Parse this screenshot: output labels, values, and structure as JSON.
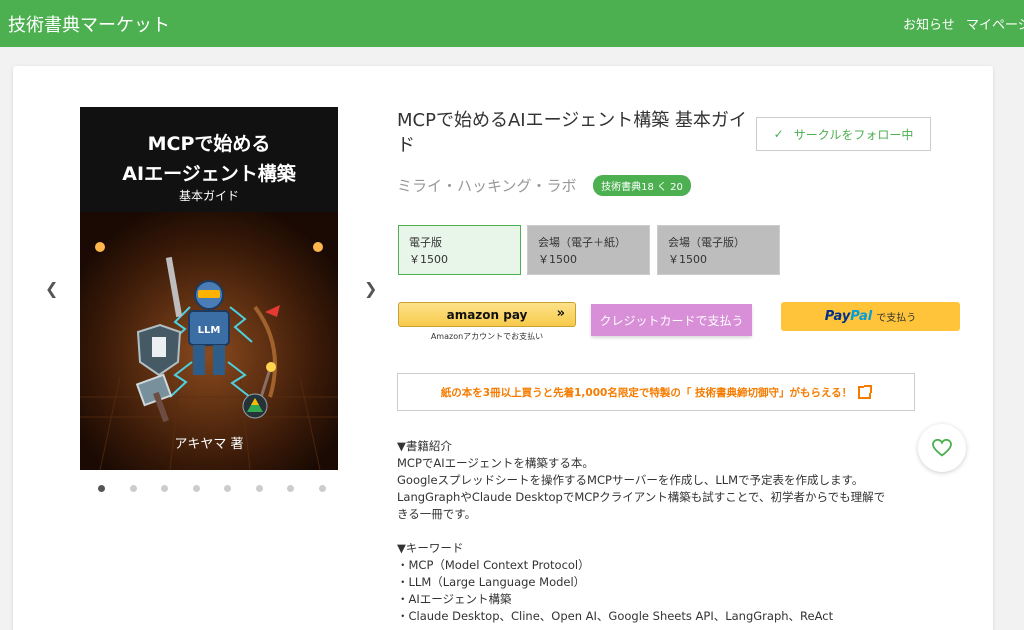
{
  "header": {
    "site_title": "技術書典マーケット",
    "nav": [
      "お知らせ",
      "マイページ"
    ]
  },
  "book": {
    "title": "MCPで始めるAIエージェント構築 基本ガイド",
    "circle": "ミライ・ハッキング・ラボ",
    "event_badge": "技術書典18 く 20",
    "follow_label": "サークルをフォロー中",
    "cover": {
      "title_line1": "MCPで始める",
      "title_line2": "AIエージェント構築",
      "subtitle": "基本ガイド",
      "robot_label": "LLM",
      "author": "アキヤマ 著"
    },
    "carousel": {
      "dot_count": 8,
      "active_index": 0
    }
  },
  "prices": [
    {
      "label": "電子版",
      "price": "￥1500",
      "selected": true
    },
    {
      "label": "会場（電子＋紙）",
      "price": "￥1500",
      "selected": false
    },
    {
      "label": "会場（電子版）",
      "price": "￥1500",
      "selected": false
    }
  ],
  "payment": {
    "amazon_label": "amazon pay",
    "amazon_caption": "Amazonアカウントでお支払い",
    "credit_label": "クレジットカードで支払う",
    "paypal_logo_a": "Pay",
    "paypal_logo_b": "Pal",
    "paypal_suffix": "で支払う"
  },
  "promo_text": "紙の本を3冊以上買うと先着1,000名限定で特製の「 技術書典締切御守」がもらえる！",
  "description": [
    "▼書籍紹介",
    "MCPでAIエージェントを構築する本。",
    "Googleスプレッドシートを操作するMCPサーバーを作成し、LLMで予定表を作成します。",
    "LangGraphやClaude DesktopでMCPクライアント構築も試すことで、初学者からでも理解で",
    "きる一冊です。",
    "",
    "▼キーワード",
    "・MCP（Model Context Protocol）",
    "・LLM（Large Language Model）",
    "・AIエージェント構築",
    "・Claude Desktop、Cline、Open AI、Google Sheets API、LangGraph、ReAct"
  ],
  "colors": {
    "header_bg": "#4caf50",
    "accent": "#4caf50",
    "promo": "#f57c00",
    "credit": "#d88fd8",
    "paypal": "#ffc439"
  }
}
